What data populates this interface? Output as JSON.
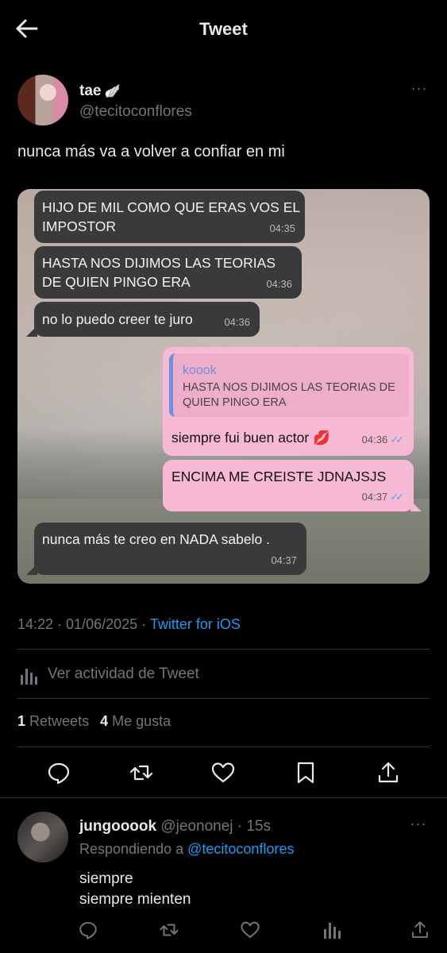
{
  "header": {
    "title": "Tweet"
  },
  "tweet": {
    "display_name": "tae",
    "handle": "@tecitoconflores",
    "text": "nunca más va a volver a confiar en mi",
    "timestamp": "14:22 · 01/06/2025",
    "separator": " · ",
    "source": "Twitter for iOS",
    "activity_label": "Ver actividad de Tweet",
    "retweets_count": "1",
    "retweets_label": "Retweets",
    "likes_count": "4",
    "likes_label": "Me gusta"
  },
  "chat": {
    "messages": [
      {
        "direction": "in",
        "text": "HIJO DE MIL COMO QUE ERAS VOS EL IMPOSTOR",
        "time": "04:35"
      },
      {
        "direction": "in",
        "text": "HASTA NOS DIJIMOS LAS TEORIAS DE QUIEN PINGO ERA",
        "time": "04:36"
      },
      {
        "direction": "in",
        "text": "no lo puedo creer te juro",
        "time": "04:36"
      },
      {
        "direction": "out",
        "quote_author": "koook",
        "quote_text": "HASTA NOS DIJIMOS LAS TEORIAS DE QUIEN PINGO ERA",
        "text": "siempre fui buen actor 💋",
        "time": "04:36",
        "read_checks": "✓✓"
      },
      {
        "direction": "out",
        "text": "ENCIMA ME CREISTE JDNAJSJS",
        "time": "04:37",
        "read_checks": "✓✓"
      },
      {
        "direction": "in",
        "text": "nunca más te creo en NADA sabelo .",
        "time": "04:37"
      }
    ]
  },
  "reply": {
    "display_name": "jungooook",
    "handle_time": "@jeononej · 15s",
    "replying_prefix": "Respondiendo a",
    "replying_to": "@tecitoconflores",
    "line1": "siempre",
    "line2": "siempre mienten"
  },
  "colors": {
    "accent": "#1d9bf0",
    "muted": "#71767b",
    "outgoing_bubble": "#f8b9d4",
    "incoming_bubble": "#3a3a3c"
  },
  "icons": [
    "back-arrow",
    "wing",
    "more-dots",
    "reply",
    "retweet",
    "like",
    "bookmark",
    "share",
    "analytics"
  ]
}
